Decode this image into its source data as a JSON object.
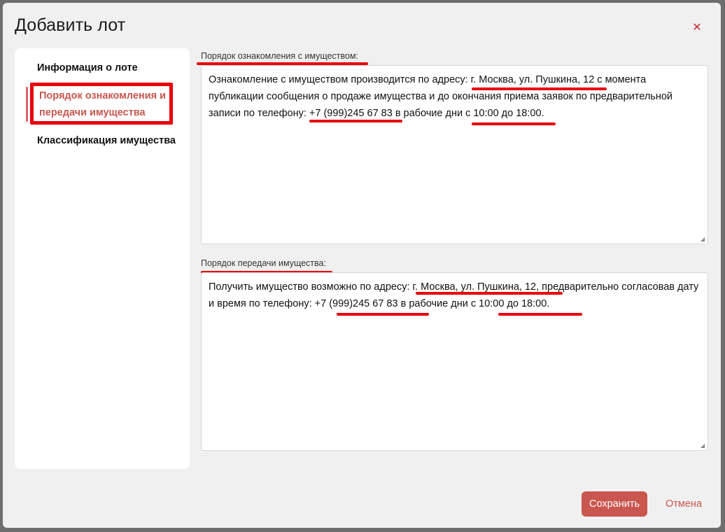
{
  "modal": {
    "title": "Добавить лот",
    "close_icon": "close-icon"
  },
  "sidebar": {
    "items": [
      {
        "label": "Информация о лоте",
        "active": false
      },
      {
        "label": "Порядок ознакомления и передачи имущества",
        "active": true
      },
      {
        "label": "Классификация имущества",
        "active": false
      }
    ]
  },
  "form": {
    "familiarization": {
      "label": "Порядок ознакомления с имуществом:",
      "text": "Ознакомление с имуществом производится по адресу: г. Москва, ул. Пушкина, 12 с момента публикации сообщения о продаже имущества  и до окончания приема заявок по предварительной записи по телефону: +7 (999)245 67 83 в рабочие дни с 10:00 до 18:00."
    },
    "transfer": {
      "label": "Порядок передачи имущества:",
      "text": "Получить имущество возможно по адресу: г. Москва, ул. Пушкина, 12, предварительно согласовав дату и время по телефону: +7 (999)245 67 83 в рабочие дни с 10:00 до 18:00."
    }
  },
  "footer": {
    "save_label": "Сохранить",
    "cancel_label": "Отмена"
  },
  "colors": {
    "accent": "#c9564f",
    "annotation": "#e8000b"
  }
}
